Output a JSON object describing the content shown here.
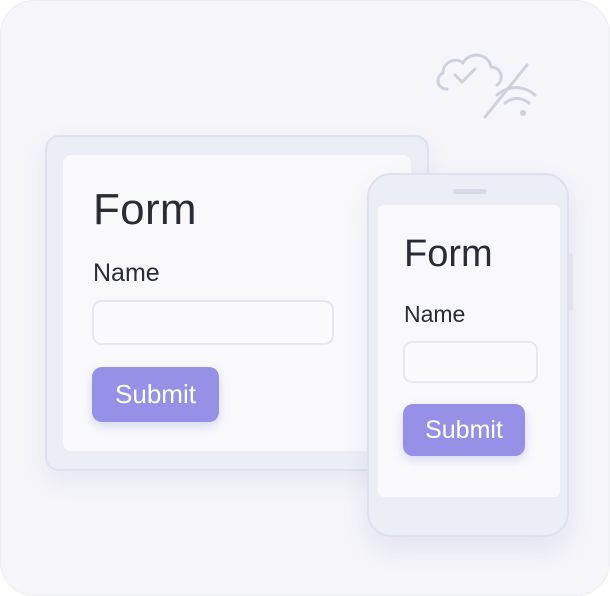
{
  "tablet_form": {
    "title": "Form",
    "name_label": "Name",
    "name_value": "",
    "submit_label": "Submit"
  },
  "phone_form": {
    "title": "Form",
    "name_label": "Name",
    "name_value": "",
    "submit_label": "Submit"
  },
  "decorations": {
    "status_icon": "cloud-check-wifi-off-icon"
  },
  "colors": {
    "accent": "#9690e6",
    "background": "#f5f5fa",
    "device_frame": "#eceef6",
    "text": "#2a2c34"
  }
}
